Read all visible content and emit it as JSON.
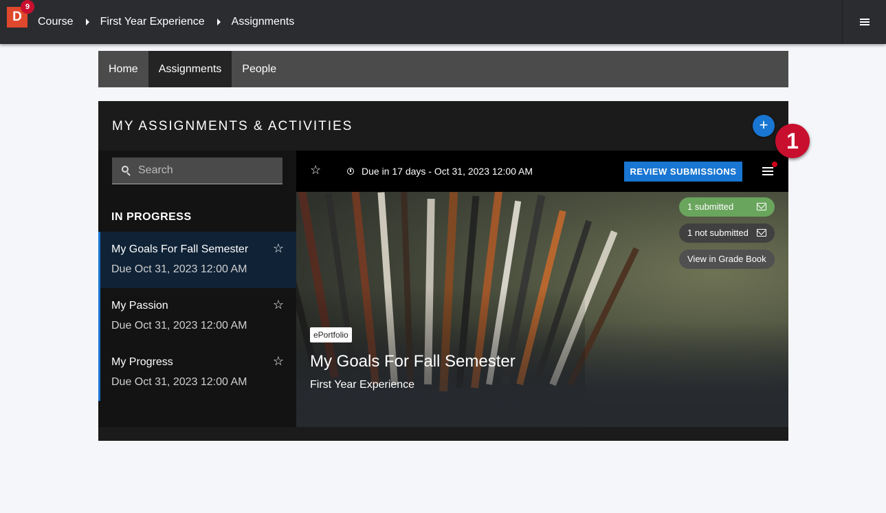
{
  "app": {
    "logo_letter": "D",
    "notification_count": "9",
    "breadcrumbs": [
      "Course",
      "First Year Experience",
      "Assignments"
    ]
  },
  "tabs": [
    {
      "label": "Home",
      "active": false
    },
    {
      "label": "Assignments",
      "active": true
    },
    {
      "label": "People",
      "active": false
    }
  ],
  "panel": {
    "title": "MY ASSIGNMENTS & ACTIVITIES",
    "add_label": "+",
    "step_badge": "1"
  },
  "search": {
    "placeholder": "Search",
    "value": ""
  },
  "sidebar": {
    "section_title": "IN PROGRESS",
    "items": [
      {
        "title": "My Goals For Fall Semester",
        "due": "Due Oct 31, 2023 12:00 AM",
        "selected": true
      },
      {
        "title": "My Passion",
        "due": "Due Oct 31, 2023 12:00 AM",
        "selected": false
      },
      {
        "title": "My Progress",
        "due": "Due Oct 31, 2023 12:00 AM",
        "selected": false
      }
    ]
  },
  "detail": {
    "due_text": "Due in 17 days - Oct 31, 2023 12:00 AM",
    "review_label": "REVIEW SUBMISSIONS",
    "submitted_label": "1 submitted",
    "not_submitted_label": "1 not submitted",
    "gradebook_label": "View in Grade Book",
    "tag": "ePortfolio",
    "title": "My Goals For Fall Semester",
    "course": "First Year Experience"
  },
  "colors": {
    "accent": "#1976d2",
    "badge_red": "#c8102e",
    "submitted_green": "#6aa55d",
    "logo_orange": "#e0482d"
  },
  "icons": [
    "star-icon",
    "clock-icon",
    "menu-icon",
    "mail-icon",
    "search-icon",
    "plus-icon"
  ]
}
